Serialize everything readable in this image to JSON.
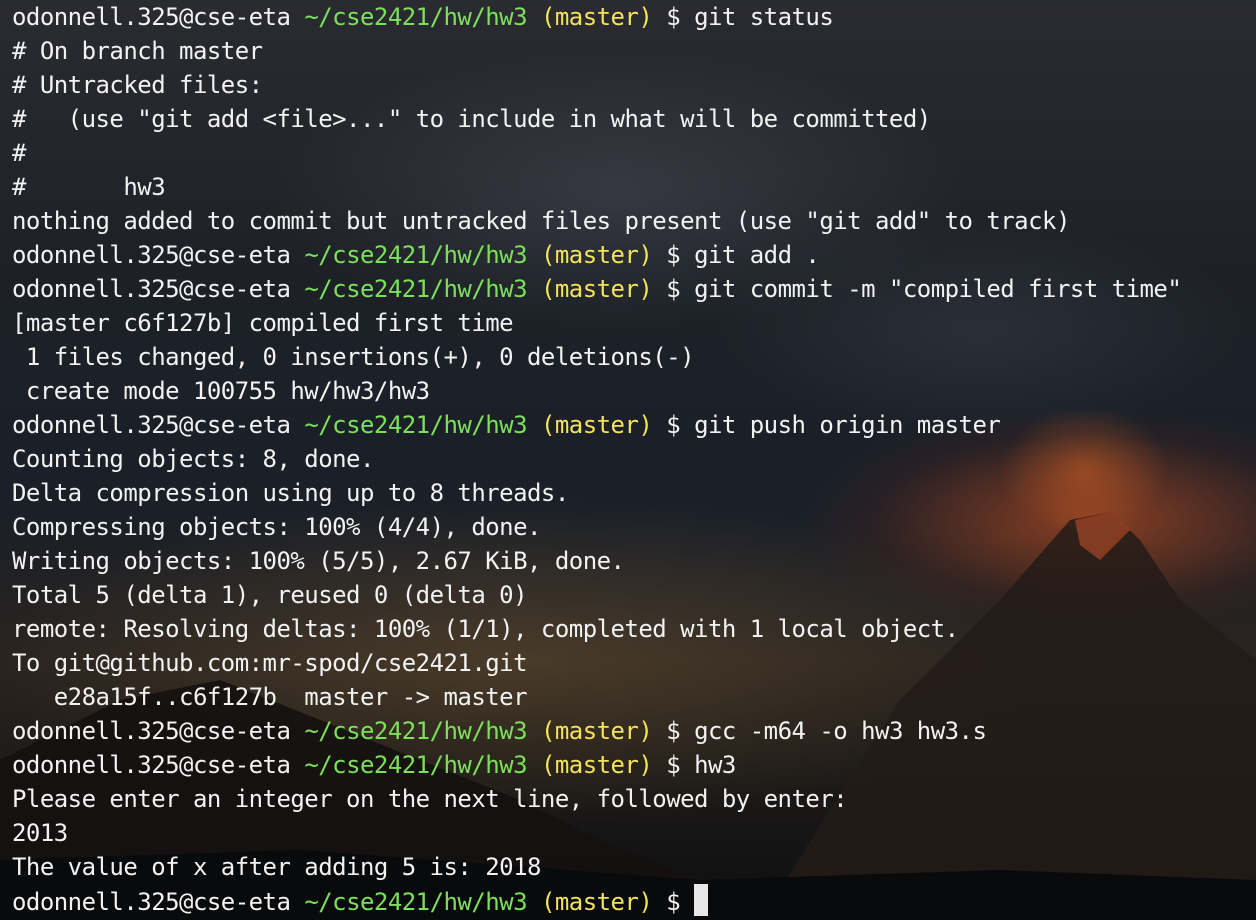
{
  "prompt": {
    "user_host": "odonnell.325@cse-eta",
    "path": "~/cse2421/hw/hw3",
    "branch": "(master)",
    "symbol": "$"
  },
  "lines": [
    {
      "type": "prompt",
      "command": "git status"
    },
    {
      "type": "output",
      "text": "# On branch master"
    },
    {
      "type": "output",
      "text": "# Untracked files:"
    },
    {
      "type": "output",
      "text": "#   (use \"git add <file>...\" to include in what will be committed)"
    },
    {
      "type": "output",
      "text": "#"
    },
    {
      "type": "output",
      "text": "#       hw3"
    },
    {
      "type": "output",
      "text": "nothing added to commit but untracked files present (use \"git add\" to track)"
    },
    {
      "type": "prompt",
      "command": "git add ."
    },
    {
      "type": "prompt",
      "command": "git commit -m \"compiled first time\""
    },
    {
      "type": "output",
      "text": "[master c6f127b] compiled first time"
    },
    {
      "type": "output",
      "text": " 1 files changed, 0 insertions(+), 0 deletions(-)"
    },
    {
      "type": "output",
      "text": " create mode 100755 hw/hw3/hw3"
    },
    {
      "type": "prompt",
      "command": "git push origin master"
    },
    {
      "type": "output",
      "text": "Counting objects: 8, done."
    },
    {
      "type": "output",
      "text": "Delta compression using up to 8 threads."
    },
    {
      "type": "output",
      "text": "Compressing objects: 100% (4/4), done."
    },
    {
      "type": "output",
      "text": "Writing objects: 100% (5/5), 2.67 KiB, done."
    },
    {
      "type": "output",
      "text": "Total 5 (delta 1), reused 0 (delta 0)"
    },
    {
      "type": "output",
      "text": "remote: Resolving deltas: 100% (1/1), completed with 1 local object."
    },
    {
      "type": "output",
      "text": "To git@github.com:mr-spod/cse2421.git"
    },
    {
      "type": "output",
      "text": "   e28a15f..c6f127b  master -> master"
    },
    {
      "type": "prompt",
      "command": "gcc -m64 -o hw3 hw3.s"
    },
    {
      "type": "prompt",
      "command": "hw3"
    },
    {
      "type": "output",
      "text": "Please enter an integer on the next line, followed by enter:"
    },
    {
      "type": "output",
      "text": "2013"
    },
    {
      "type": "output",
      "text": "The value of x after adding 5 is: 2018"
    },
    {
      "type": "prompt",
      "command": "",
      "cursor": true
    }
  ],
  "colors": {
    "text": "#f2f2f2",
    "path": "#7de05a",
    "branch": "#f4e25a",
    "cursor": "#e8e8e8"
  }
}
